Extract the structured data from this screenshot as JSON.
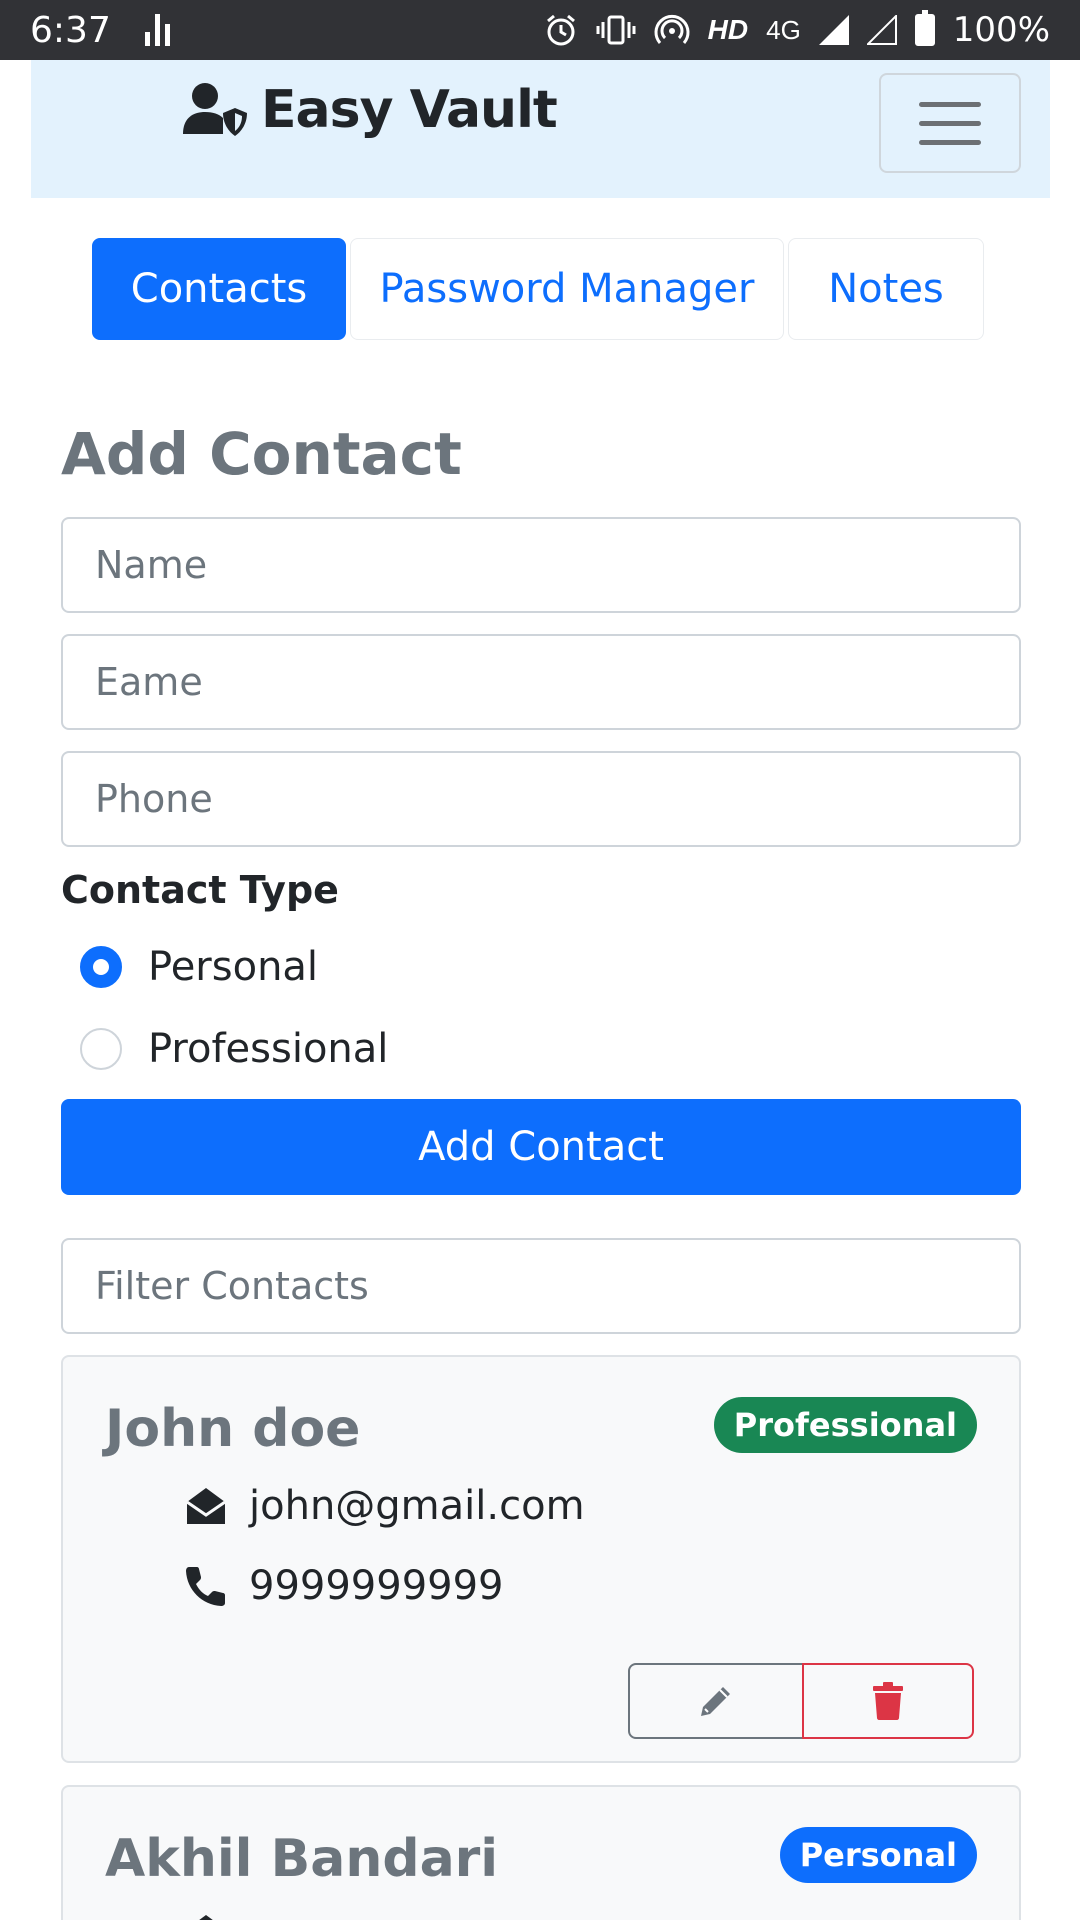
{
  "status_bar": {
    "time": "6:37",
    "hd": "HD",
    "network": "4G",
    "battery": "100%"
  },
  "navbar": {
    "brand": "Easy Vault"
  },
  "tabs": [
    {
      "label": "Contacts",
      "active": true
    },
    {
      "label": "Password Manager",
      "active": false
    },
    {
      "label": "Notes",
      "active": false
    }
  ],
  "form": {
    "title": "Add Contact",
    "name_placeholder": "Name",
    "email_placeholder": "Eame",
    "phone_placeholder": "Phone",
    "contact_type_label": "Contact Type",
    "options": [
      {
        "label": "Personal",
        "checked": true
      },
      {
        "label": "Professional",
        "checked": false
      }
    ],
    "submit_label": "Add Contact"
  },
  "filter": {
    "placeholder": "Filter Contacts"
  },
  "contacts": [
    {
      "name": "John doe",
      "type": "Professional",
      "email": "john@gmail.com",
      "phone": "9999999999"
    },
    {
      "name": "Akhil Bandari",
      "type": "Personal"
    }
  ],
  "colors": {
    "primary": "#0d6efd",
    "success": "#198754",
    "danger": "#dc3545",
    "navbar_bg": "#e3f2fd"
  }
}
